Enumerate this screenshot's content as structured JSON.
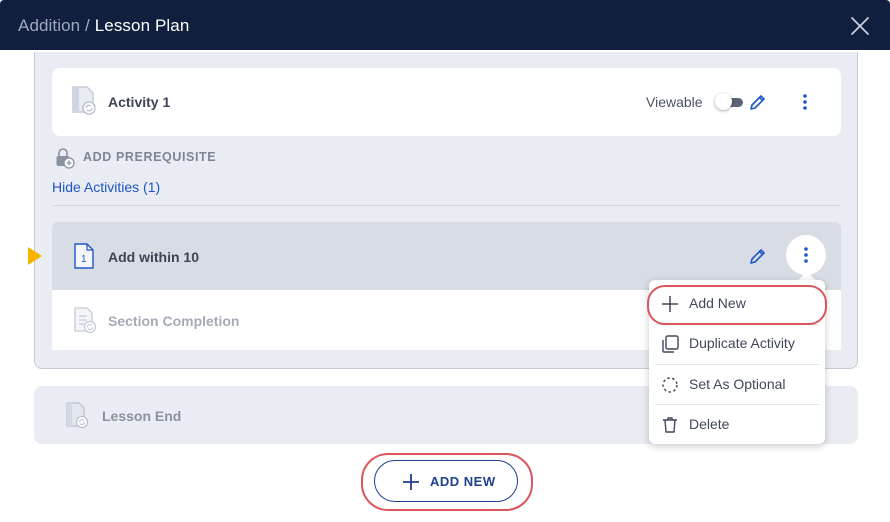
{
  "header": {
    "breadcrumb_parent": "Addition",
    "breadcrumb_separator": " / ",
    "breadcrumb_current": "Lesson Plan",
    "close_icon": "close-icon"
  },
  "activity_card": {
    "title": "Activity 1",
    "icon": "activity-doc-icon",
    "viewable_label": "Viewable",
    "viewable_on": false,
    "edit_icon": "pencil-icon",
    "more_icon": "kebab-vertical-icon"
  },
  "prerequisite": {
    "label": "ADD PREREQUISITE",
    "icon": "lock-plus-icon"
  },
  "hide_activities_label": "Hide Activities (1)",
  "section": {
    "title": "Add within 10",
    "number": "1",
    "pointer_color": "#f4b400"
  },
  "section_completion_label": "Section Completion",
  "context_menu": {
    "items": [
      {
        "label": "Add New",
        "icon": "plus-icon"
      },
      {
        "label": "Duplicate Activity",
        "icon": "duplicate-icon"
      },
      {
        "label": "Set As Optional",
        "icon": "dashed-circle-icon"
      },
      {
        "label": "Delete",
        "icon": "trash-icon"
      }
    ]
  },
  "lesson_end_label": "Lesson End",
  "add_new_button_label": "ADD NEW",
  "colors": {
    "header_bg": "#0f1f3d",
    "link_blue": "#1f56c9",
    "highlight_ring": "#d9575c",
    "button_navy": "#1f3f8f"
  }
}
